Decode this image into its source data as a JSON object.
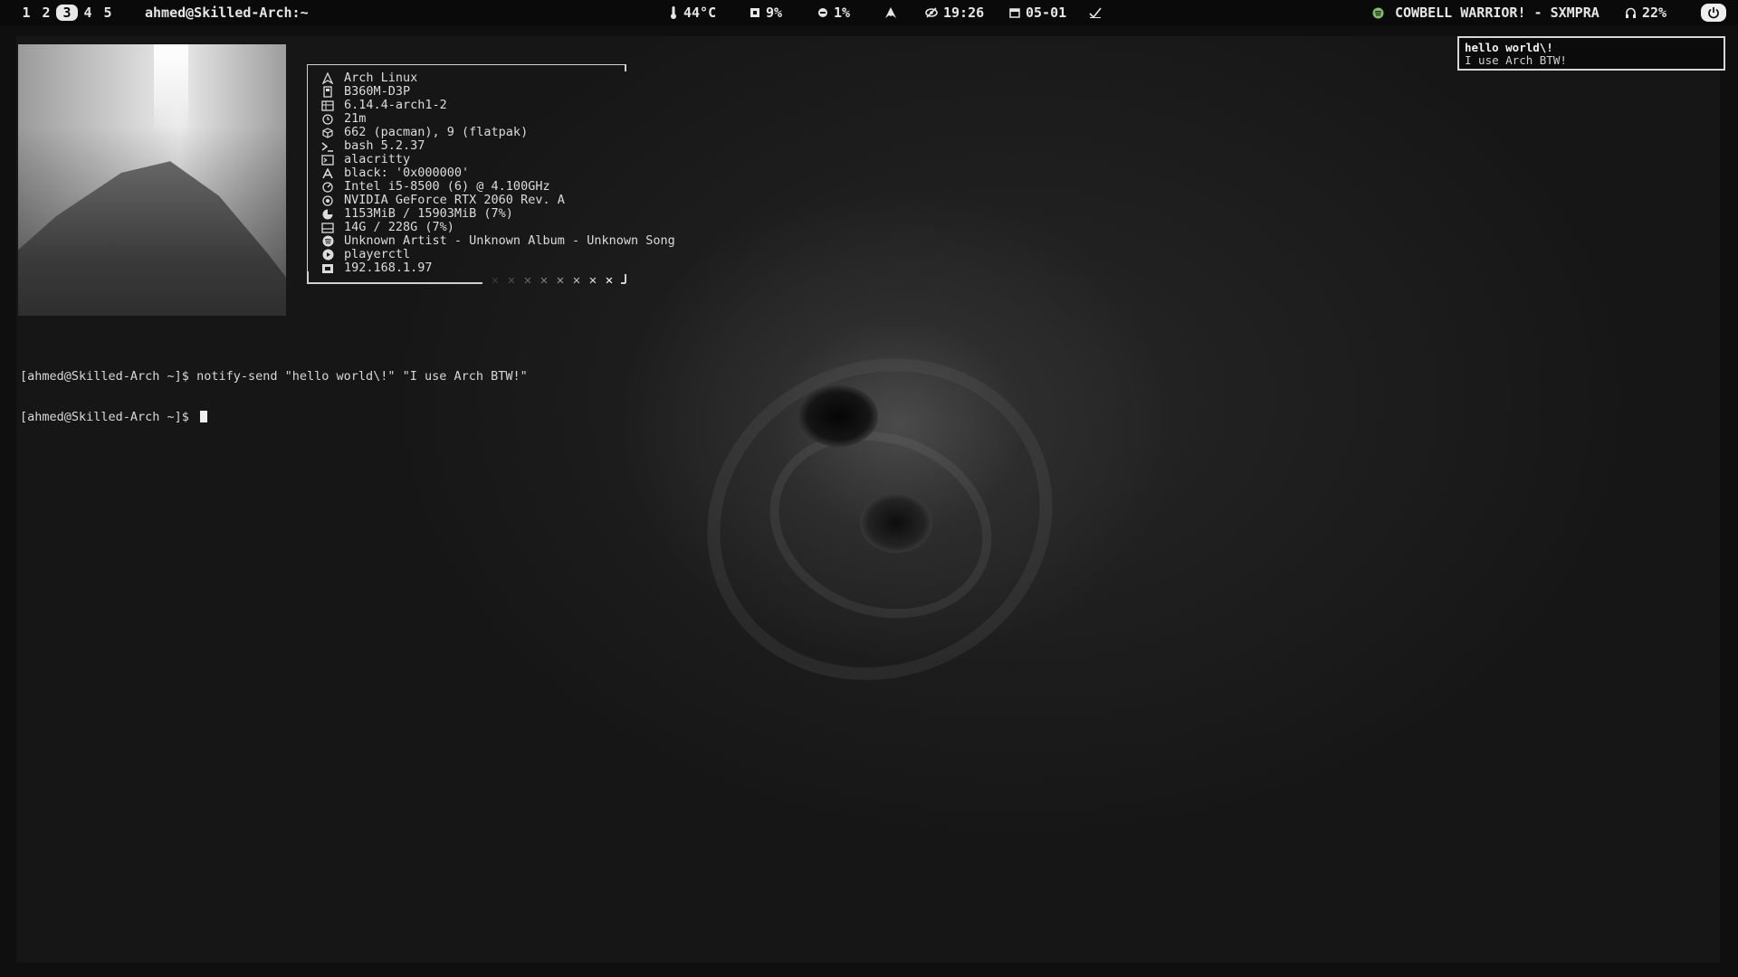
{
  "topbar": {
    "workspaces": [
      "1",
      "2",
      "3",
      "4",
      "5"
    ],
    "active_workspace": "3",
    "window_title": "ahmed@Skilled-Arch:~",
    "temperature": "44°C",
    "cpu": "9%",
    "memory": "1%",
    "clock": "19:26",
    "date": "05-01",
    "music": "COWBELL WARRIOR! - SXMPRA",
    "volume": "22%"
  },
  "fastfetch": {
    "lines": [
      {
        "icon": "arch-icon",
        "text": "Arch Linux"
      },
      {
        "icon": "motherboard-icon",
        "text": "B360M-D3P"
      },
      {
        "icon": "kernel-icon",
        "text": "6.14.4-arch1-2"
      },
      {
        "icon": "clock-icon",
        "text": "21m"
      },
      {
        "icon": "package-icon",
        "text": "662 (pacman), 9 (flatpak)"
      },
      {
        "icon": "shell-icon",
        "text": "bash 5.2.37"
      },
      {
        "icon": "terminal-icon",
        "text": "alacritty"
      },
      {
        "icon": "font-icon",
        "text": "black: '0x000000'"
      },
      {
        "icon": "cpu-icon",
        "text": "Intel i5-8500 (6) @ 4.100GHz"
      },
      {
        "icon": "gpu-icon",
        "text": "NVIDIA GeForce RTX 2060 Rev. A"
      },
      {
        "icon": "memory-icon",
        "text": "1153MiB / 15903MiB (7%)"
      },
      {
        "icon": "disk-icon",
        "text": "14G / 228G (7%)"
      },
      {
        "icon": "spotify-icon",
        "text": "Unknown Artist - Unknown Album - Unknown Song"
      },
      {
        "icon": "play-icon",
        "text": "playerctl"
      },
      {
        "icon": "network-icon",
        "text": "192.168.1.97"
      }
    ],
    "color_blocks": [
      "✕",
      "✕",
      "✕",
      "✕",
      "✕",
      "✕",
      "✕",
      "✕"
    ]
  },
  "terminal": {
    "line1": "[ahmed@Skilled-Arch ~]$ notify-send \"hello world\\!\" \"I use Arch BTW!\"",
    "line2": "[ahmed@Skilled-Arch ~]$ "
  },
  "notification": {
    "summary": "hello world\\!",
    "body": "I use Arch BTW!"
  }
}
